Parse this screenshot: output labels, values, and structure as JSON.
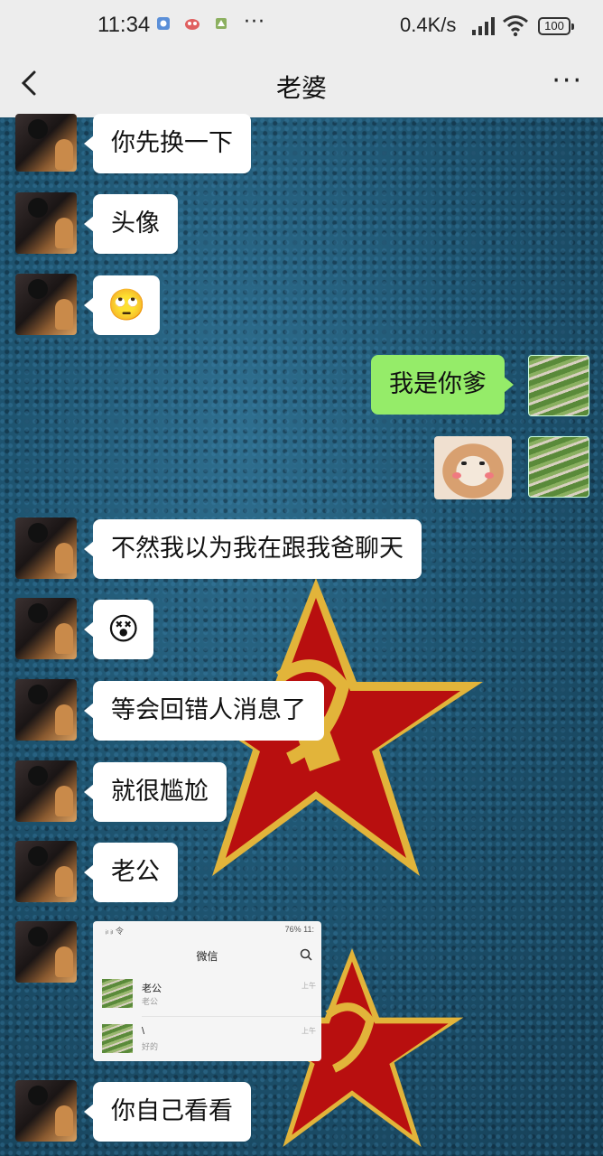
{
  "status_bar": {
    "time": "11:34",
    "more": "···",
    "net_speed": "0.4K/s",
    "battery": "100"
  },
  "nav": {
    "title": "老婆",
    "more": "···"
  },
  "messages": [
    {
      "from": "her",
      "text": "你先换一下"
    },
    {
      "from": "her",
      "text": "头像"
    },
    {
      "from": "her",
      "emoji": "🙄"
    },
    {
      "from": "me",
      "text": "我是你爹"
    },
    {
      "from": "me",
      "type": "sticker",
      "icon": "shiba-dog-sticker"
    },
    {
      "from": "her",
      "text": "不然我以为我在跟我爸聊天"
    },
    {
      "from": "her",
      "emoji": "😵"
    },
    {
      "from": "her",
      "text": "等会回错人消息了"
    },
    {
      "from": "her",
      "text": "就很尴尬"
    },
    {
      "from": "her",
      "text": "老公"
    },
    {
      "from": "her",
      "type": "image"
    },
    {
      "from": "her",
      "text": "你自己看看"
    }
  ],
  "screenshot": {
    "status_left": "ᵢₗ ᵢₗ 令",
    "status_right": "76% 11:",
    "title": "微信",
    "rows": [
      {
        "name": "老公",
        "preview": "老公",
        "time": "上午"
      },
      {
        "name": "\\",
        "preview": "好的",
        "time": "上午"
      }
    ]
  },
  "colors": {
    "header_bg": "#ededed",
    "my_bubble": "#95ec69",
    "their_bubble": "#ffffff",
    "star_red": "#c01010",
    "star_gold": "#e2b43a"
  }
}
